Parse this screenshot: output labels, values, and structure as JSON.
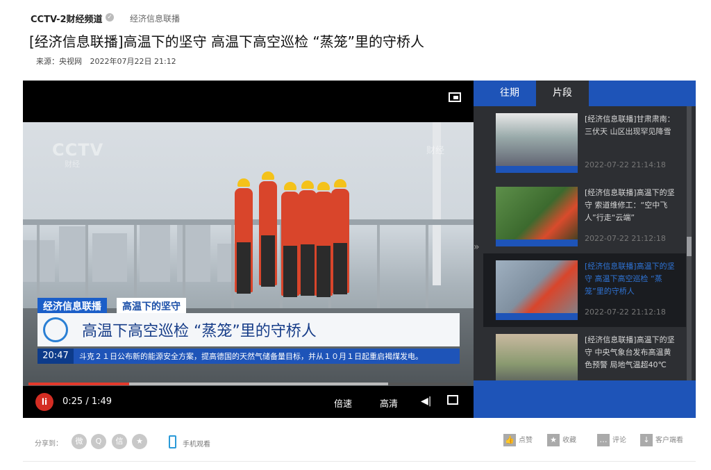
{
  "header": {
    "channel": "CCTV-2财经频道",
    "channel_sub": "经济信息联播",
    "title": "[经济信息联播]高温下的坚守 高温下高空巡检 “蒸笼”里的守桥人",
    "source": "来源：央视网",
    "date": "2022年07月22日 21:12"
  },
  "player": {
    "watermark": "CCTV",
    "watermark_sub": "财经",
    "corner_logo": "财经",
    "tag_program": "经济信息联播",
    "tag_topic": "高温下的坚守",
    "headline": "高温下高空巡检 “蒸笼”里的守桥人",
    "ticker_time": "20:47",
    "ticker_text": "斗克２１日公布新的能源安全方案，提高德国的天然气储备量目标，并从１０月１日起重启褐煤发电。",
    "time_display": "0:25 / 1:49",
    "progress": 0.229,
    "buffered": 0.82,
    "play_label": "li",
    "speed_label": "倍速",
    "quality_label": "高清"
  },
  "sidebar": {
    "tabs": [
      "往期",
      "片段"
    ],
    "active_tab": 1,
    "clips": [
      {
        "title": "[经济信息联播]甘肃肃南：三伏天 山区出现罕见降雪",
        "date": "2022-07-22 21:14:18",
        "active": false
      },
      {
        "title": "[经济信息联播]高温下的坚守 索道维修工：“空中飞人”行走“云端”",
        "date": "2022-07-22 21:12:18",
        "active": false
      },
      {
        "title": "[经济信息联播]高温下的坚守 高温下高空巡检 “蒸笼”里的守桥人",
        "date": "2022-07-22 21:12:18",
        "active": true
      },
      {
        "title": "[经济信息联播]高温下的坚守 中央气象台发布高温黄色预警 局地气温超40℃",
        "date": "",
        "active": false
      }
    ]
  },
  "footer": {
    "share_label": "分享到：",
    "phone_label": "手机观看",
    "like_label": "点赞",
    "fav_label": "收藏",
    "comment_label": "评论",
    "client_label": "客户端看"
  },
  "colors": {
    "accent": "#1e54b8",
    "progress": "#e33a2c",
    "sidebar_bg": "#2d2f33"
  }
}
